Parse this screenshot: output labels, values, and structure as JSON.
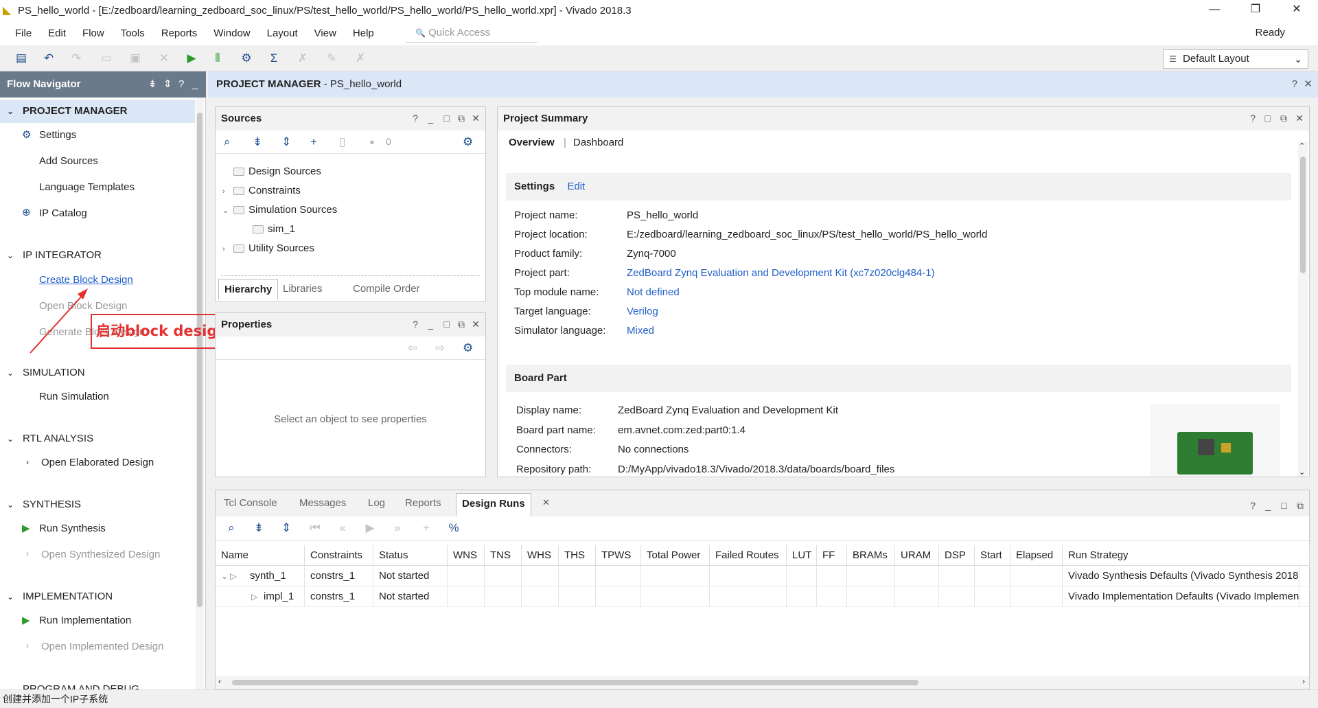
{
  "window": {
    "title": "PS_hello_world - [E:/zedboard/learning_zedboard_soc_linux/PS/test_hello_world/PS_hello_world/PS_hello_world.xpr] - Vivado 2018.3"
  },
  "menu": [
    "File",
    "Edit",
    "Flow",
    "Tools",
    "Reports",
    "Window",
    "Layout",
    "View",
    "Help"
  ],
  "quick_access": {
    "placeholder": "Quick Access"
  },
  "status_ready": "Ready",
  "layout_select": {
    "value": "Default Layout"
  },
  "flow_navigator": {
    "title": "Flow Navigator",
    "sections": [
      {
        "label": "PROJECT MANAGER",
        "items": [
          "Settings",
          "Add Sources",
          "Language Templates",
          "IP Catalog"
        ]
      },
      {
        "label": "IP INTEGRATOR",
        "items": [
          "Create Block Design",
          "Open Block Design",
          "Generate Block Design"
        ]
      },
      {
        "label": "SIMULATION",
        "items": [
          "Run Simulation"
        ]
      },
      {
        "label": "RTL ANALYSIS",
        "items": [
          "Open Elaborated Design"
        ]
      },
      {
        "label": "SYNTHESIS",
        "items": [
          "Run Synthesis",
          "Open Synthesized Design"
        ]
      },
      {
        "label": "IMPLEMENTATION",
        "items": [
          "Run Implementation",
          "Open Implemented Design"
        ]
      },
      {
        "label": "PROGRAM AND DEBUG",
        "items": []
      }
    ]
  },
  "annotation": {
    "text": "启动block design"
  },
  "status_bar": {
    "text": "创建并添加一个IP子系统"
  },
  "main_header": {
    "title": "PROJECT MANAGER",
    "subtitle": " - PS_hello_world"
  },
  "sources": {
    "title": "Sources",
    "count": "0",
    "tree": [
      "Design Sources",
      "Constraints",
      "Simulation Sources",
      "sim_1",
      "Utility Sources"
    ],
    "tabs": [
      "Hierarchy",
      "Libraries",
      "Compile Order"
    ]
  },
  "properties": {
    "title": "Properties",
    "empty_text": "Select an object to see properties"
  },
  "summary": {
    "title": "Project Summary",
    "tabs": [
      "Overview",
      "Dashboard"
    ],
    "settings_title": "Settings",
    "edit_label": "Edit",
    "settings": [
      {
        "label": "Project name:",
        "value": "PS_hello_world"
      },
      {
        "label": "Project location:",
        "value": "E:/zedboard/learning_zedboard_soc_linux/PS/test_hello_world/PS_hello_world"
      },
      {
        "label": "Product family:",
        "value": "Zynq-7000"
      },
      {
        "label": "Project part:",
        "value": "ZedBoard Zynq Evaluation and Development Kit (xc7z020clg484-1)"
      },
      {
        "label": "Top module name:",
        "value": "Not defined"
      },
      {
        "label": "Target language:",
        "value": "Verilog"
      },
      {
        "label": "Simulator language:",
        "value": "Mixed"
      }
    ],
    "board_title": "Board Part",
    "board": [
      {
        "label": "Display name:",
        "value": "ZedBoard Zynq Evaluation and Development Kit"
      },
      {
        "label": "Board part name:",
        "value": "em.avnet.com:zed:part0:1.4"
      },
      {
        "label": "Connectors:",
        "value": "No connections"
      },
      {
        "label": "Repository path:",
        "value": "D:/MyApp/vivado18.3/Vivado/2018.3/data/boards/board_files"
      }
    ]
  },
  "bottom": {
    "tabs": [
      "Tcl Console",
      "Messages",
      "Log",
      "Reports",
      "Design Runs"
    ],
    "columns": [
      "Name",
      "Constraints",
      "Status",
      "WNS",
      "TNS",
      "WHS",
      "THS",
      "TPWS",
      "Total Power",
      "Failed Routes",
      "LUT",
      "FF",
      "BRAMs",
      "URAM",
      "DSP",
      "Start",
      "Elapsed",
      "Run Strategy"
    ],
    "rows": [
      {
        "name": "synth_1",
        "constraints": "constrs_1",
        "status": "Not started",
        "strategy": "Vivado Synthesis Defaults (Vivado Synthesis 2018)"
      },
      {
        "name": "impl_1",
        "constraints": "constrs_1",
        "status": "Not started",
        "strategy": "Vivado Implementation Defaults (Vivado Implementatic"
      }
    ]
  }
}
